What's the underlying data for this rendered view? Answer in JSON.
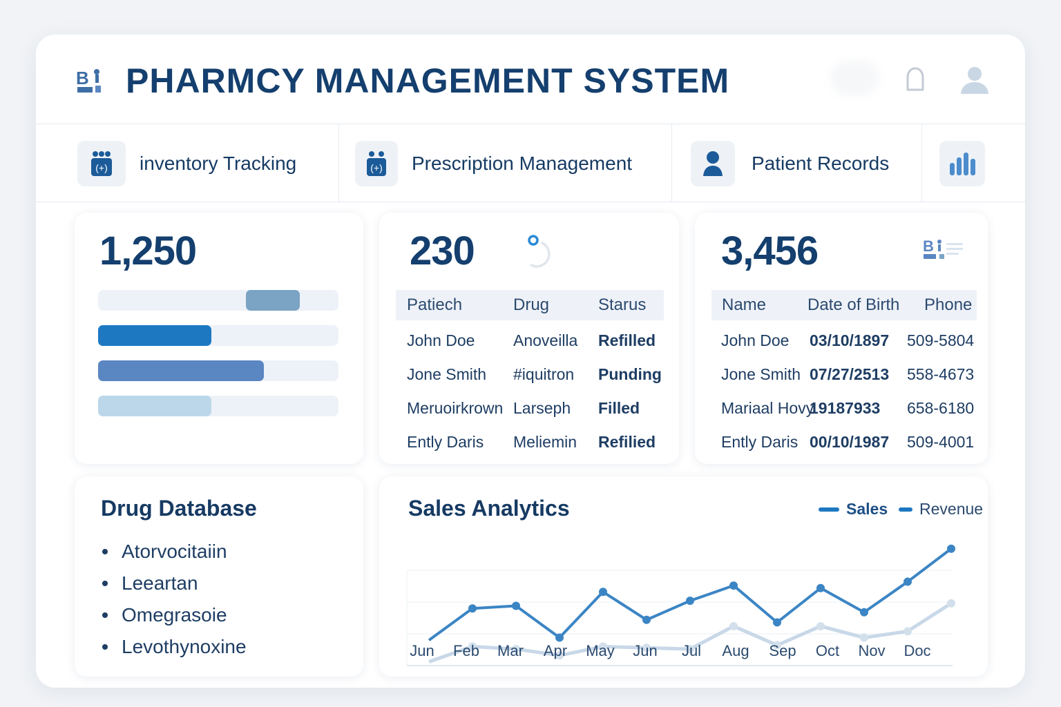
{
  "header": {
    "title": "PHARMCY MANAGEMENT SYSTEM",
    "logo_icon": "pharmacy-logo-icon",
    "bell_icon": "bell-icon",
    "user_icon": "user-icon"
  },
  "nav": {
    "items": [
      {
        "label": "inventory Tracking",
        "icon": "medicine-box-icon"
      },
      {
        "label": "Prescription Management",
        "icon": "medicine-box-icon"
      },
      {
        "label": "Patient Records",
        "icon": "person-icon"
      },
      {
        "label": "",
        "icon": "bar-chart-icon"
      }
    ]
  },
  "inventory_card": {
    "count": "1,250",
    "bars": [
      {
        "start": 0.615,
        "fraction": 0.225,
        "color": "#7aa3c4"
      },
      {
        "start": 0,
        "fraction": 0.47,
        "color": "#1d78c1"
      },
      {
        "start": 0,
        "fraction": 0.69,
        "color": "#5a86c2"
      },
      {
        "start": 0,
        "fraction": 0.47,
        "color": "#bcd7ea"
      }
    ]
  },
  "prescription_card": {
    "count": "230",
    "columns": [
      "Patiech",
      "Drug",
      "Starus"
    ],
    "rows": [
      [
        "John Doe",
        "Anoveilla",
        "Refilled"
      ],
      [
        "Jone Smith",
        "#iquitron",
        "Punding"
      ],
      [
        "Meruoirkrown",
        "Larseph",
        "Filled"
      ],
      [
        "Ently Daris",
        "Meliemin",
        "Refilied"
      ]
    ]
  },
  "patient_card": {
    "count": "3,456",
    "columns": [
      "Name",
      "Date of Birth",
      "Phone"
    ],
    "rows": [
      [
        "John Doe",
        "03/10/1897",
        "509-5804"
      ],
      [
        "Jone Smith",
        "07/27/2513",
        "558-4673"
      ],
      [
        "Mariaal Hovy",
        "19187933",
        "658-6180"
      ],
      [
        "Ently Daris",
        "00/10/1987",
        "509-4001"
      ]
    ]
  },
  "drug_database": {
    "title": "Drug Database",
    "items": [
      "Atorvocitaiin",
      "Leeartan",
      "Omegrasoie",
      "Levothynoxine"
    ]
  },
  "sales": {
    "title": "Sales Analytics",
    "legend": [
      "Sales",
      "Revenue"
    ]
  },
  "colors": {
    "primary": "#143f6e",
    "accent": "#1d78c1",
    "sales_line": "#3b85c4",
    "revenue_line": "#c8d8e8"
  },
  "chart_data": {
    "type": "line",
    "categories": [
      "Jun",
      "Feb",
      "Mar",
      "Apr",
      "May",
      "Jun",
      "Jul",
      "Aug",
      "Sep",
      "Oct",
      "Nov",
      "Doc"
    ],
    "series": [
      {
        "name": "Sales",
        "values": [
          20,
          45,
          47,
          22,
          58,
          36,
          51,
          63,
          34,
          61,
          42,
          66,
          92
        ]
      },
      {
        "name": "Revenue",
        "values": [
          3,
          15,
          13,
          8,
          15,
          14,
          13,
          31,
          16,
          31,
          22,
          27,
          49
        ]
      }
    ],
    "extra_point_note": "",
    "ylim": [
      0,
      100
    ],
    "grid": true,
    "legend_position": "top-right"
  }
}
